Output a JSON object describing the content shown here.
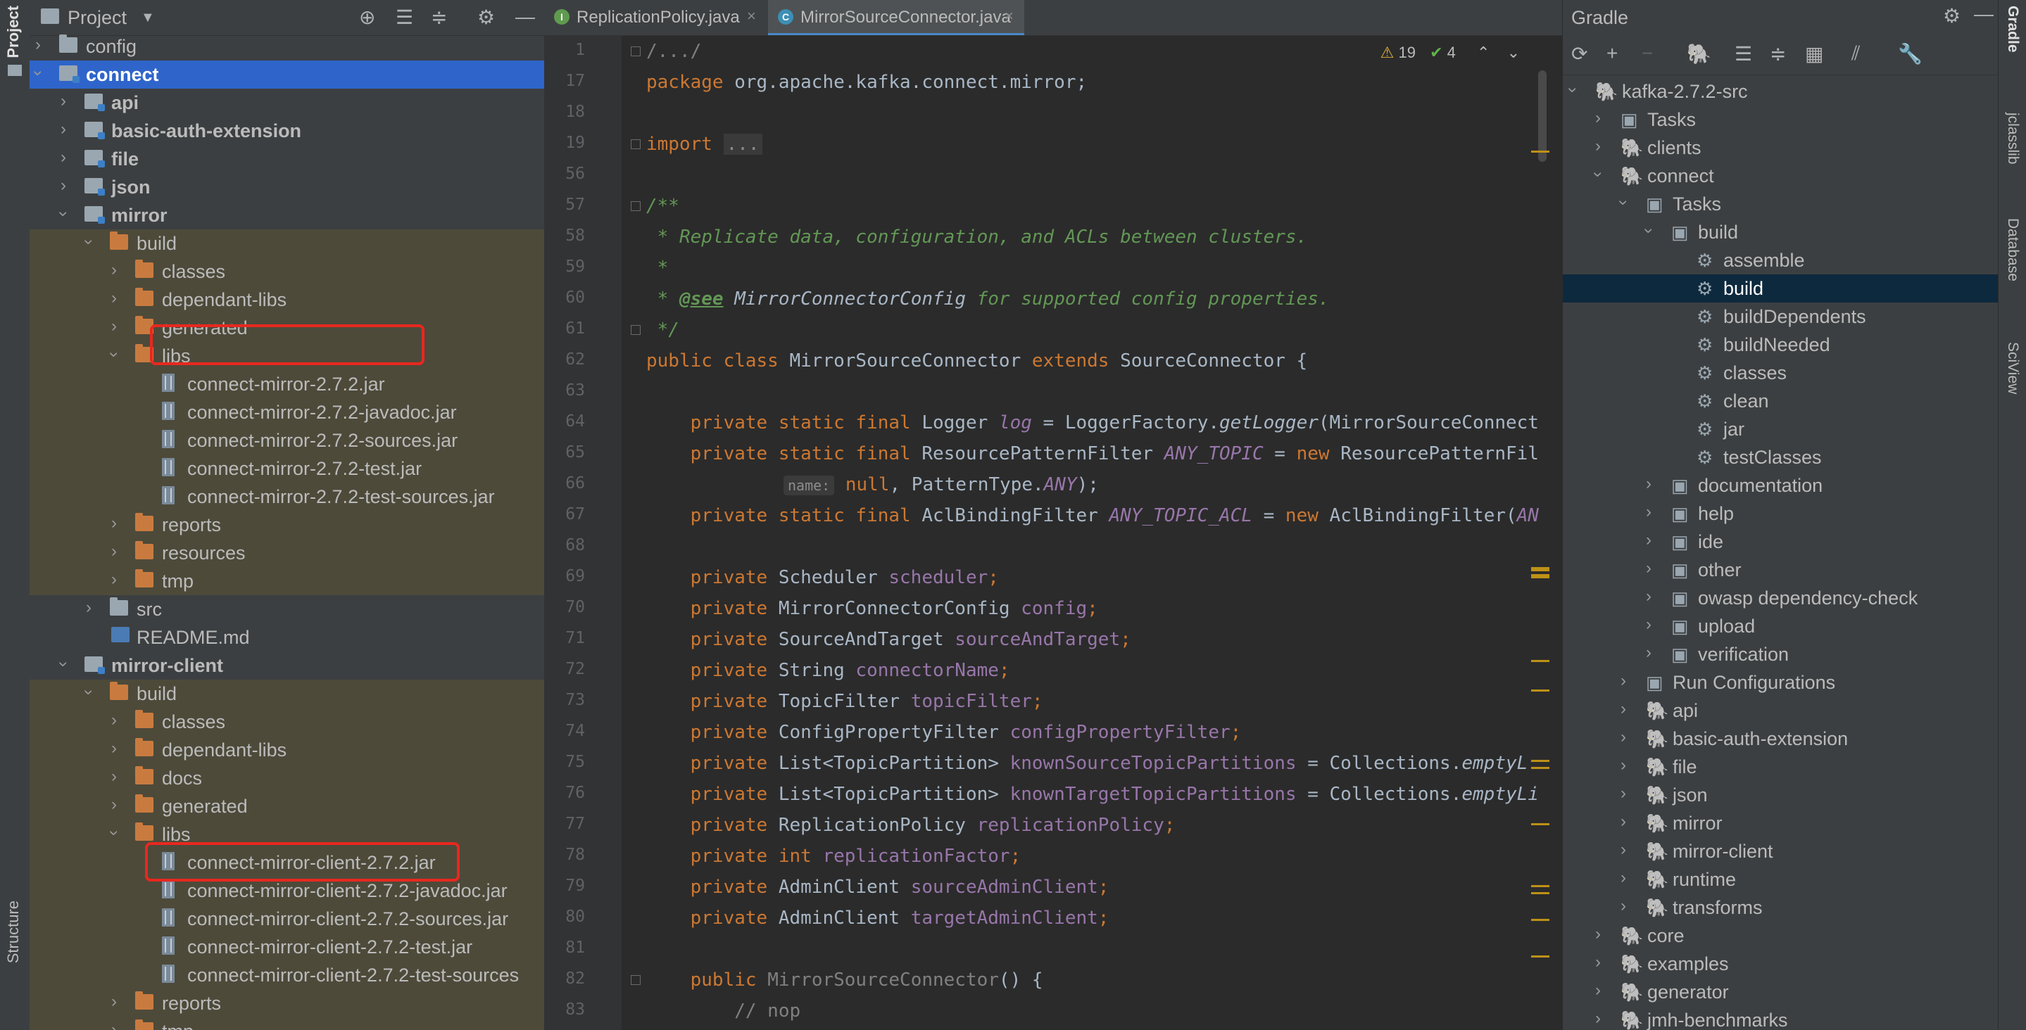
{
  "left_strip": {
    "project_tab": "Project",
    "structure_tab": "Structure"
  },
  "project": {
    "title": "Project",
    "rows": [
      {
        "label": "config"
      },
      {
        "label": "connect"
      },
      {
        "label": "api"
      },
      {
        "label": "basic-auth-extension"
      },
      {
        "label": "file"
      },
      {
        "label": "json"
      },
      {
        "label": "mirror"
      },
      {
        "label": "build"
      },
      {
        "label": "classes"
      },
      {
        "label": "dependant-libs"
      },
      {
        "label": "generated"
      },
      {
        "label": "libs"
      },
      {
        "label": "connect-mirror-2.7.2.jar"
      },
      {
        "label": "connect-mirror-2.7.2-javadoc.jar"
      },
      {
        "label": "connect-mirror-2.7.2-sources.jar"
      },
      {
        "label": "connect-mirror-2.7.2-test.jar"
      },
      {
        "label": "connect-mirror-2.7.2-test-sources.jar"
      },
      {
        "label": "reports"
      },
      {
        "label": "resources"
      },
      {
        "label": "tmp"
      },
      {
        "label": "src"
      },
      {
        "label": "README.md"
      },
      {
        "label": "mirror-client"
      },
      {
        "label": "build"
      },
      {
        "label": "classes"
      },
      {
        "label": "dependant-libs"
      },
      {
        "label": "docs"
      },
      {
        "label": "generated"
      },
      {
        "label": "libs"
      },
      {
        "label": "connect-mirror-client-2.7.2.jar"
      },
      {
        "label": "connect-mirror-client-2.7.2-javadoc.jar"
      },
      {
        "label": "connect-mirror-client-2.7.2-sources.jar"
      },
      {
        "label": "connect-mirror-client-2.7.2-test.jar"
      },
      {
        "label": "connect-mirror-client-2.7.2-test-sources"
      },
      {
        "label": "reports"
      },
      {
        "label": "tmp"
      }
    ]
  },
  "editor": {
    "tabs": [
      {
        "label": "ReplicationPolicy.java",
        "icon": "I"
      },
      {
        "label": "MirrorSourceConnector.java",
        "icon": "C"
      }
    ],
    "inspections": {
      "warnings": "19",
      "weak_warnings": "4"
    },
    "line_numbers": [
      "1",
      "17",
      "18",
      "19",
      "56",
      "57",
      "58",
      "59",
      "60",
      "61",
      "62",
      "63",
      "64",
      "65",
      "66",
      "67",
      "68",
      "69",
      "70",
      "71",
      "72",
      "73",
      "74",
      "75",
      "76",
      "77",
      "78",
      "79",
      "80",
      "81",
      "82",
      "83"
    ],
    "code": {
      "l1": "/.../",
      "l17_kw": "package",
      "l17_rest": " org.apache.kafka.connect.mirror;",
      "l19_kw": "import",
      "l19_rest": "...",
      "l57": "/**",
      "l58": " * Replicate data, configuration, and ACLs between clusters.",
      "l59": " *",
      "l60_a": " * ",
      "l60_tag": "@see",
      "l60_ref": " MirrorConnectorConfig",
      "l60_b": " for supported config properties.",
      "l61": " */",
      "l62_kw": "public class",
      "l62_a": " MirrorSourceConnector ",
      "l62_kw2": "extends",
      "l62_b": " SourceConnector {",
      "l64_kw": "    private static final",
      "l64_a": " Logger ",
      "l64_f": "log",
      "l64_b": " = LoggerFactory.",
      "l64_m": "getLogger",
      "l64_c": "(MirrorSourceConnect",
      "l65_kw": "    private static final",
      "l65_a": " ResourcePatternFilter ",
      "l65_f": "ANY_TOPIC",
      "l65_b": " = ",
      "l65_kw2": "new",
      "l65_c": " ResourcePatternFil",
      "l66_hint": "name:",
      "l66_kw": " null",
      "l66_a": ", PatternType.",
      "l66_f": "ANY",
      "l66_b": ");",
      "l67_kw": "    private static final",
      "l67_a": " AclBindingFilter ",
      "l67_f": "ANY_TOPIC_ACL",
      "l67_b": " = ",
      "l67_kw2": "new",
      "l67_c": " AclBindingFilter(",
      "l67_f2": "AN",
      "fields": [
        {
          "type": " Scheduler ",
          "name": "scheduler",
          "kw": "    private"
        },
        {
          "type": " MirrorConnectorConfig ",
          "name": "config",
          "kw": "    private"
        },
        {
          "type": " SourceAndTarget ",
          "name": "sourceAndTarget",
          "kw": "    private"
        },
        {
          "type": " String ",
          "name": "connectorName",
          "kw": "    private"
        },
        {
          "type": " TopicFilter ",
          "name": "topicFilter",
          "kw": "    private"
        },
        {
          "type": " ConfigPropertyFilter ",
          "name": "configPropertyFilter",
          "kw": "    private"
        }
      ],
      "l75_kw": "    private",
      "l75_a": " List<TopicPartition> ",
      "l75_f": "knownSourceTopicPartitions",
      "l75_b": " = Collections.",
      "l75_m": "emptyL",
      "l76_kw": "    private",
      "l76_a": " List<TopicPartition> ",
      "l76_f": "knownTargetTopicPartitions",
      "l76_b": " = Collections.",
      "l76_m": "emptyLi",
      "l77_kw": "    private",
      "l77_a": " ReplicationPolicy ",
      "l77_f": "replicationPolicy",
      "l78_kw": "    private int",
      "l78_f": " replicationFactor",
      "l79_kw": "    private",
      "l79_a": " AdminClient ",
      "l79_f": "sourceAdminClient",
      "l80_kw": "    private",
      "l80_a": " AdminClient ",
      "l80_f": "targetAdminClient",
      "semi": ";",
      "l82_kw": "    public",
      "l82_a": " MirrorSourceConnector",
      "l82_b": "() {",
      "l83": "        // nop"
    }
  },
  "gradle": {
    "title": "Gradle",
    "rows": [
      {
        "label": "kafka-2.7.2-src"
      },
      {
        "label": "Tasks"
      },
      {
        "label": "clients"
      },
      {
        "label": "connect"
      },
      {
        "label": "Tasks"
      },
      {
        "label": "build"
      },
      {
        "label": "assemble"
      },
      {
        "label": "build"
      },
      {
        "label": "buildDependents"
      },
      {
        "label": "buildNeeded"
      },
      {
        "label": "classes"
      },
      {
        "label": "clean"
      },
      {
        "label": "jar"
      },
      {
        "label": "testClasses"
      },
      {
        "label": "documentation"
      },
      {
        "label": "help"
      },
      {
        "label": "ide"
      },
      {
        "label": "other"
      },
      {
        "label": "owasp dependency-check"
      },
      {
        "label": "upload"
      },
      {
        "label": "verification"
      },
      {
        "label": "Run Configurations"
      },
      {
        "label": "api"
      },
      {
        "label": "basic-auth-extension"
      },
      {
        "label": "file"
      },
      {
        "label": "json"
      },
      {
        "label": "mirror"
      },
      {
        "label": "mirror-client"
      },
      {
        "label": "runtime"
      },
      {
        "label": "transforms"
      },
      {
        "label": "core"
      },
      {
        "label": "examples"
      },
      {
        "label": "generator"
      },
      {
        "label": "jmh-benchmarks"
      }
    ]
  },
  "right_strip": {
    "gradle_tab": "Gradle",
    "jclasslib_tab": "jclasslib",
    "database_tab": "Database",
    "sciview_tab": "SciView"
  }
}
